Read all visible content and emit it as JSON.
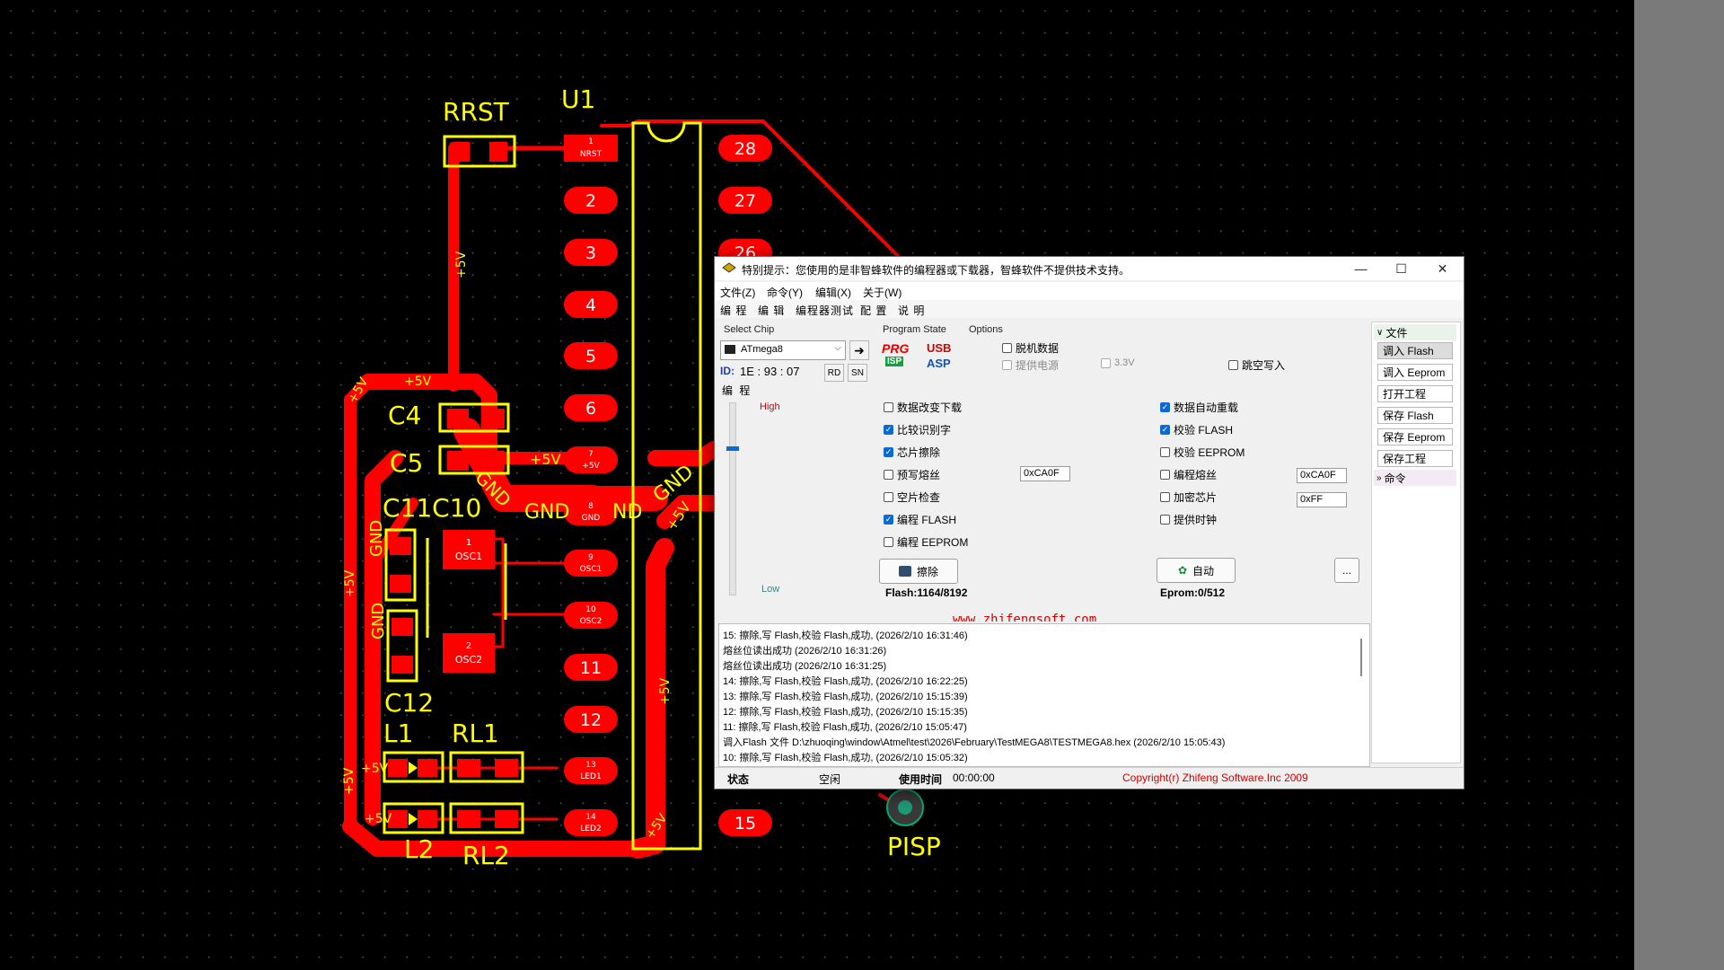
{
  "pcb": {
    "designators": {
      "rrst": "RRST",
      "u1": "U1",
      "c4": "C4",
      "c5": "C5",
      "c11c10": "C11C10",
      "c12": "C12",
      "l1": "L1",
      "rl1": "RL1",
      "l2": "L2",
      "rl2": "RL2",
      "pisp": "PISP"
    },
    "left_pads": [
      {
        "num": "1",
        "net": "NRST"
      },
      {
        "num": "2",
        "net": ""
      },
      {
        "num": "3",
        "net": ""
      },
      {
        "num": "4",
        "net": ""
      },
      {
        "num": "5",
        "net": ""
      },
      {
        "num": "6",
        "net": ""
      },
      {
        "num": "7",
        "net": "+5V"
      },
      {
        "num": "8",
        "net": "GND"
      },
      {
        "num": "9",
        "net": "OSC1"
      },
      {
        "num": "10",
        "net": "OSC2"
      },
      {
        "num": "11",
        "net": ""
      },
      {
        "num": "12",
        "net": ""
      },
      {
        "num": "13",
        "net": "LED1"
      },
      {
        "num": "14",
        "net": "LED2"
      }
    ],
    "right_pads": [
      "28",
      "27",
      "26",
      "15"
    ],
    "net_labels": {
      "p5v": "+5V",
      "gnd": "GND",
      "osc1_pad": "OSC1",
      "osc2_pad": "OSC2",
      "osc1_num": "1",
      "osc2_num": "2",
      "nd": "ND"
    }
  },
  "window": {
    "title": "特别提示：您使用的是非智蜂软件的编程器或下载器，智蜂软件不提供技术支持。",
    "controls": {
      "minimize": "—",
      "maximize": "☐",
      "close": "✕"
    },
    "menu": [
      "文件(Z)",
      "命令(Y)",
      "编辑(X)",
      "关于(W)"
    ],
    "tabs": [
      "编 程",
      "编 辑",
      "编程器测试",
      "配 置",
      "说 明"
    ],
    "select_chip": {
      "label": "Select Chip",
      "value": "ATmega8",
      "id_label": "ID:",
      "id_value": "1E : 93 : 07",
      "rd": "RD",
      "sn": "SN"
    },
    "program_state": {
      "label": "Program State",
      "prg": "PRG",
      "isp": "ISP",
      "usb": "USB",
      "asp": "ASP"
    },
    "options": {
      "label": "Options",
      "offline": "脱机数据",
      "power": "提供电源",
      "v33": "3.3V",
      "skip_empty": "跳空写入"
    },
    "prog_group_label": "编 程",
    "speed": {
      "high": "High",
      "low": "Low"
    },
    "left_checks": [
      {
        "label": "数据改变下载",
        "checked": false
      },
      {
        "label": "比较识别字",
        "checked": true
      },
      {
        "label": "芯片擦除",
        "checked": true
      },
      {
        "label": "预写熔丝",
        "checked": false
      },
      {
        "label": "空片检查",
        "checked": false
      },
      {
        "label": "编程 FLASH",
        "checked": true
      },
      {
        "label": "编程 EEPROM",
        "checked": false
      }
    ],
    "right_checks": [
      {
        "label": "数据自动重载",
        "checked": true
      },
      {
        "label": "校验 FLASH",
        "checked": true
      },
      {
        "label": "校验 EEPROM",
        "checked": false
      },
      {
        "label": "编程熔丝",
        "checked": false
      },
      {
        "label": "加密芯片",
        "checked": false
      },
      {
        "label": "提供时钟",
        "checked": false
      }
    ],
    "fuse_left_value": "0xCA0F",
    "fuse_right_value": "0xCA0F",
    "lock_value": "0xFF",
    "erase_button": "擦除",
    "auto_button": "自动",
    "more_button": "...",
    "flash_usage": "Flash:1164/8192",
    "eprom_usage": "Eprom:0/512",
    "url": "www.zhifengsoft.com",
    "log": [
      "15: 擦除,写 Flash,校验 Flash,成功, (2026/2/10 16:31:46)",
      "熔丝位读出成功 (2026/2/10 16:31:26)",
      "熔丝位读出成功 (2026/2/10 16:31:25)",
      "14: 擦除,写 Flash,校验 Flash,成功, (2026/2/10 16:22:25)",
      "13: 擦除,写 Flash,校验 Flash,成功, (2026/2/10 15:15:39)",
      "12: 擦除,写 Flash,校验 Flash,成功, (2026/2/10 15:15:35)",
      "11: 擦除,写 Flash,校验 Flash,成功, (2026/2/10 15:05:47)",
      "调入Flash 文件 D:\\zhuoqing\\window\\Atmel\\test\\2026\\February\\TestMEGA8\\TESTMEGA8.hex (2026/2/10 15:05:43)",
      "10: 擦除,写 Flash,校验 Flash,成功, (2026/2/10 15:05:32)"
    ],
    "status": {
      "state_label": "状态",
      "state_value": "空闲",
      "time_label": "使用时间",
      "time_value": "00:00:00",
      "copyright": "Copyright(r) Zhifeng Software.Inc 2009"
    },
    "side_panel": {
      "file_header": "文件",
      "items": [
        "调入 Flash",
        "调入 Eeprom",
        "打开工程",
        "保存 Flash",
        "保存 Eeprom",
        "保存工程"
      ],
      "cmd_header": "命令"
    }
  },
  "colors": {
    "copper": "#ff0000",
    "silkscreen": "#ffff00",
    "pad_text": "#ffffff"
  }
}
